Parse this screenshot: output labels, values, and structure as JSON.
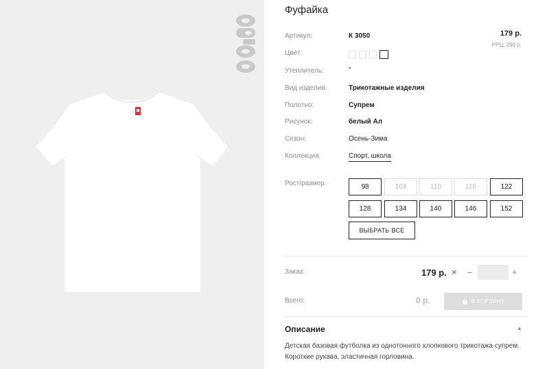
{
  "product": {
    "title": "Фуфайка",
    "brand": "optop"
  },
  "properties": {
    "article_label": "Артикул:",
    "article_value": "К 3050",
    "color_label": "Цвет:",
    "insulation_label": "Утеплитель:",
    "insulation_value": "\"",
    "type_label": "Вид изделия:",
    "type_value": "Трикотажные изделия",
    "fabric_label": "Полотно:",
    "fabric_value": "Супрем",
    "print_label": "Рисунок:",
    "print_value": "белый Ал",
    "season_label": "Сезон:",
    "season_value": "Осень-Зима",
    "collection_label": "Коллекция:",
    "collection_value": "Спорт, школа"
  },
  "price": {
    "value": "179 р.",
    "rrp": "РРЦ: 299 р."
  },
  "swatches": [
    {
      "name": "swatch-1",
      "color": "#ffffff",
      "selected": false
    },
    {
      "name": "swatch-2",
      "color": "#ffffff",
      "selected": false
    },
    {
      "name": "swatch-3",
      "color": "#ffffff",
      "selected": false
    },
    {
      "name": "swatch-4",
      "color": "#ffffff",
      "selected": true
    }
  ],
  "sizes": {
    "label": "Рост/размер:",
    "row1": [
      {
        "label": "98",
        "available": true
      },
      {
        "label": "104",
        "available": false
      },
      {
        "label": "110",
        "available": false
      },
      {
        "label": "116",
        "available": false
      },
      {
        "label": "122",
        "available": true
      }
    ],
    "row2": [
      {
        "label": "128",
        "available": true
      },
      {
        "label": "134",
        "available": true
      },
      {
        "label": "140",
        "available": true
      },
      {
        "label": "146",
        "available": true
      },
      {
        "label": "152",
        "available": true
      }
    ],
    "select_all_label": "ВЫБРАТЬ ВСЕ"
  },
  "order": {
    "label": "Заказ:",
    "price": "179 р.",
    "times_symbol": "×",
    "minus_symbol": "–",
    "plus_symbol": "+",
    "quantity_value": ""
  },
  "total": {
    "label": "Всего:",
    "value": "0 р.",
    "cart_button_label": "В КОРЗИНУ"
  },
  "description": {
    "title": "Описание",
    "text": "Детская базовая футболка из однотонного хлопкового трикотажа супрем. Короткие рукава, эластичная горловина."
  },
  "colors": {
    "accent_label_red": "#e0342f",
    "disabled_gray": "#dcdcdc"
  },
  "icons": {
    "cart": "lock-icon",
    "collapse": "chevron-up-icon",
    "remove": "times-icon"
  }
}
